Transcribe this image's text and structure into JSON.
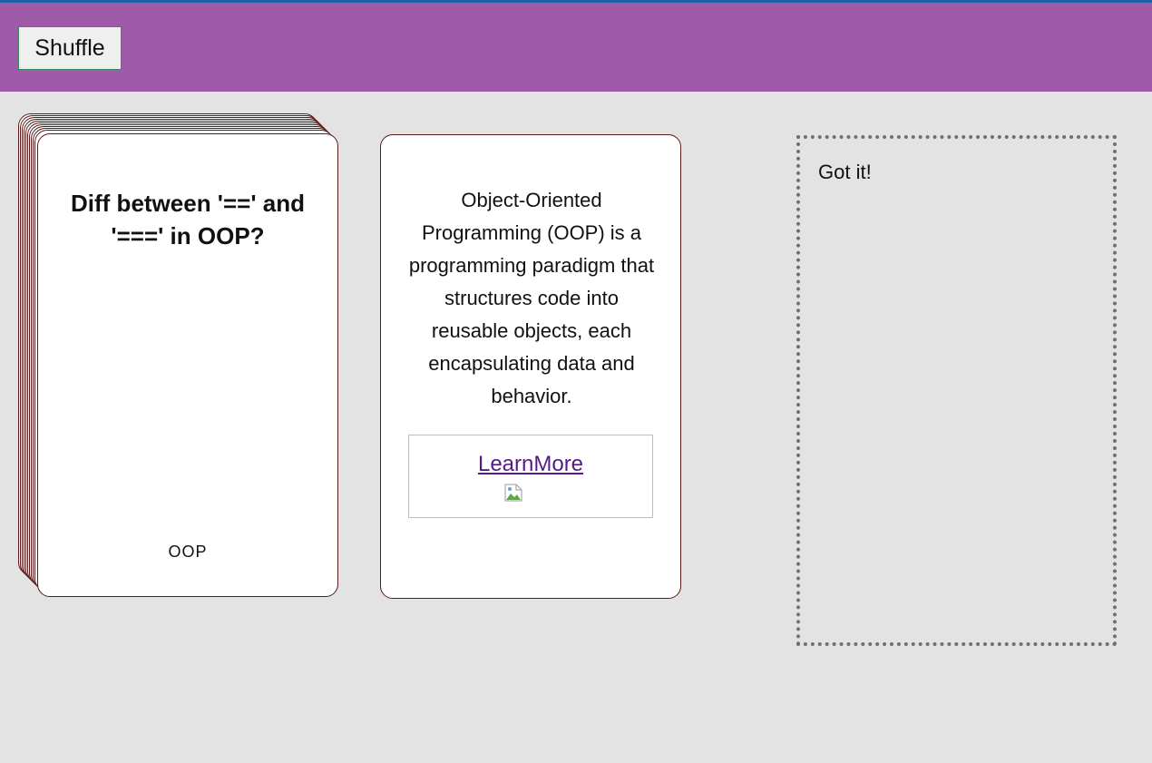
{
  "header": {
    "shuffle_label": "Shuffle",
    "accent_color": "#a05aaa"
  },
  "deck": {
    "question": "Diff between '==' and '===' in OOP?",
    "category": "OOP"
  },
  "answer_card": {
    "text": "Object-Oriented Programming (OOP) is a programming paradigm that structures code into reusable objects, each encapsulating data and behavior.",
    "link_label": "LearnMore",
    "image_icon": "broken-image-icon"
  },
  "drop_zone": {
    "label": "Got it!"
  }
}
